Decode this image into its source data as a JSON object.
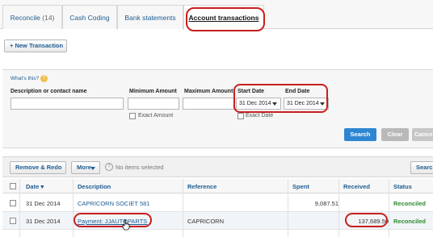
{
  "tabs": {
    "reconcile_label": "Reconcile",
    "reconcile_count": "(14)",
    "cash_coding": "Cash Coding",
    "bank_statements": "Bank statements",
    "account_transactions": "Account transactions"
  },
  "toolbar": {
    "new_transaction": "+ New Transaction"
  },
  "filter": {
    "whats_this": "What's this?",
    "description_label": "Description or contact name",
    "min_amount_label": "Minimum Amount",
    "max_amount_label": "Maximum Amount",
    "start_date_label": "Start Date",
    "end_date_label": "End Date",
    "start_date_value": "31 Dec 2014",
    "end_date_value": "31 Dec 2014",
    "exact_amount": "Exact Amount",
    "exact_date": "Exact Date",
    "search": "Search",
    "clear": "Clear",
    "cancel": "Cance"
  },
  "actions": {
    "remove_redo": "Remove & Redo",
    "more": "More",
    "no_items": "No items selected",
    "search": "Searc"
  },
  "table": {
    "headers": {
      "date": "Date",
      "description": "Description",
      "reference": "Reference",
      "spent": "Spent",
      "received": "Received",
      "status": "Status"
    },
    "rows": [
      {
        "date": "31 Dec 2014",
        "description": "CAPRICORN SOCIET 581",
        "reference": "",
        "spent": "9,087.51",
        "received": "",
        "status": "Reconciled"
      },
      {
        "date": "31 Dec 2014",
        "description": "Payment: JJAUTOPARTS",
        "reference": "CAPRICORN",
        "spent": "",
        "received": "137,689.50",
        "status": "Reconciled"
      }
    ]
  },
  "colors": {
    "link": "#1c5c93",
    "search_button": "#2e86d1",
    "clear_button": "#b9b9b9",
    "reconciled": "#2d8a2d",
    "annotation_red": "#c81e1e"
  }
}
